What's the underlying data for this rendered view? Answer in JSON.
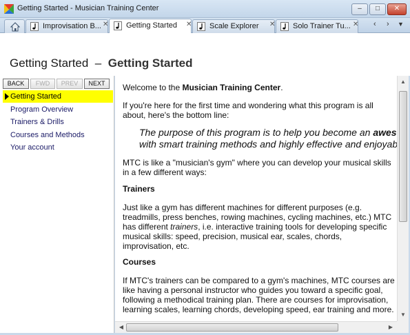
{
  "window": {
    "title": "Getting Started - Musician Training Center",
    "controls": [
      "minimize",
      "maximize",
      "close"
    ]
  },
  "tabs": [
    {
      "label": "Improvisation B...",
      "active": false
    },
    {
      "label": "Getting Started",
      "active": true
    },
    {
      "label": "Scale Explorer",
      "active": false
    },
    {
      "label": "Solo Trainer Tu...",
      "active": false
    }
  ],
  "header": {
    "section": "Getting Started",
    "separator": "–",
    "page": "Getting Started"
  },
  "nav_buttons": {
    "back": "BACK",
    "fwd": "FWD",
    "prev": "PREV",
    "next": "NEXT"
  },
  "sidebar": {
    "items": [
      {
        "label": "Getting Started",
        "selected": true
      },
      {
        "label": "Program Overview",
        "selected": false
      },
      {
        "label": "Trainers & Drills",
        "selected": false
      },
      {
        "label": "Courses and Methods",
        "selected": false
      },
      {
        "label": "Your account",
        "selected": false
      }
    ]
  },
  "content": {
    "welcome_prefix": "Welcome to the ",
    "welcome_bold": "Musician Training Center",
    "welcome_suffix": ".",
    "intro": "If you're here for the first time and wondering what this program is all about, here's the bottom line:",
    "quote_line1_prefix": "The purpose of this program is to help you become an ",
    "quote_line1_bold": "awesom",
    "quote_line2": "with smart training methods and highly effective and enjoyable",
    "gym": "MTC is like a \"musician's gym\" where you can develop your musical skills in a few different ways:",
    "trainers_heading": "Trainers",
    "trainers_text_prefix": "Just like a gym has different machines for different purposes (e.g. treadmills, press benches, rowing machines, cycling machines, etc.) MTC has different ",
    "trainers_text_italic": "trainers",
    "trainers_text_suffix": ", i.e. interactive training tools for developing specific musical skills: speed, precision, musical ear, scales, chords, improvisation, etc.",
    "courses_heading": "Courses",
    "courses_text": "If MTC's trainers can be compared to a gym's machines, MTC courses are like having a personal instructor who guides you toward a specific goal, following a methodical training plan. There are courses for improvisation, learning scales, learning chords, developing speed, ear training and more."
  },
  "colors": {
    "selected_bg": "#ffff00",
    "link_text": "#1a1a66",
    "window_chrome": "#c9d9ea"
  },
  "icons": [
    "app-icon",
    "home-icon",
    "music-note-icon",
    "close-icon",
    "chevron-left-icon",
    "chevron-right-icon",
    "chevron-down-icon",
    "triangle-right-icon"
  ]
}
